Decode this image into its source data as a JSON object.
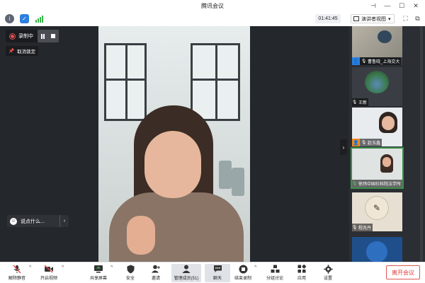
{
  "window": {
    "title": "腾讯会议",
    "controls": {
      "pin": "⊣",
      "minimize": "—",
      "maximize": "☐",
      "close": "✕"
    }
  },
  "toolbar": {
    "meeting_time": "01:41:45",
    "view_label": "演讲者视图",
    "view_caret": "▾",
    "fullscreen_glyph": "⛶",
    "layout_glyph": "⧉"
  },
  "recording": {
    "label": "录制中",
    "unlock_label": "取消锁定",
    "pin_glyph": "📌"
  },
  "say_something": {
    "placeholder": "说点什么...",
    "smile_glyph": "☺",
    "chevron": "‹"
  },
  "collapse_chevron": "›",
  "participants": [
    {
      "name": "曹鲁晓_上海交大",
      "badge": "blue",
      "badge_glyph": "👤",
      "mic_glyph": "🎙"
    },
    {
      "name": "王新",
      "badge": "",
      "badge_glyph": "",
      "mic_glyph": "🎙"
    },
    {
      "name": "赵玉鑫",
      "badge": "orange",
      "badge_glyph": "👤",
      "mic_glyph": "🎙"
    },
    {
      "name": "徐玮中国社科院法学所",
      "badge": "",
      "badge_glyph": "",
      "mic_glyph": "🎙"
    },
    {
      "name": "程兆丹",
      "badge": "",
      "badge_glyph": "",
      "mic_glyph": "🎙"
    },
    {
      "name": "",
      "badge": "",
      "badge_glyph": "",
      "mic_glyph": ""
    }
  ],
  "bottombar": {
    "unmute": "解除静音",
    "start_video": "开启视频",
    "share_screen": "共享屏幕",
    "security": "安全",
    "invite": "邀请",
    "manage_members": "管理成员(51)",
    "chat": "聊天",
    "end_recording": "结束录制",
    "breakout": "分组讨论",
    "apps": "应用",
    "settings": "设置",
    "leave": "离开会议",
    "caret": "^"
  },
  "colors": {
    "accent_blue": "#2d7fe0",
    "recording_red": "#e34c4c",
    "active_green": "#3a8f4a",
    "leave_red": "#e03a3a",
    "stage_bg": "#24272b"
  }
}
